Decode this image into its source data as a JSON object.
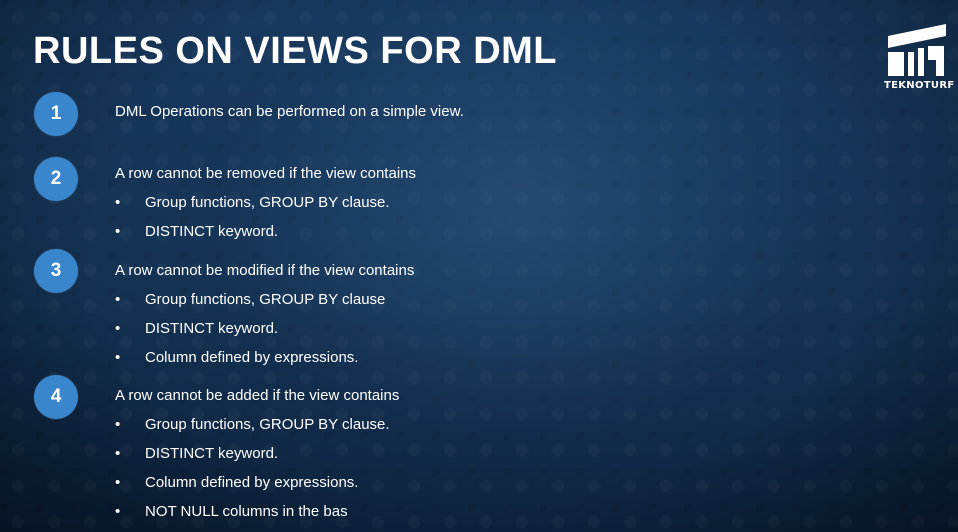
{
  "slide": {
    "title": "RULES ON VIEWS FOR DML",
    "logo": {
      "text": "TEKNOTURF",
      "icon": "teknoturf-logo-icon"
    },
    "rules": [
      {
        "number": "1",
        "heading": "DML Operations can be performed on a simple view.",
        "bullets": []
      },
      {
        "number": "2",
        "heading": "A row cannot be removed if the view contains",
        "bullets": [
          "Group functions,  GROUP BY clause.",
          "DISTINCT keyword."
        ]
      },
      {
        "number": "3",
        "heading": "A row cannot be modified if the view contains",
        "bullets": [
          "Group functions,  GROUP BY clause",
          "DISTINCT keyword.",
          "Column defined by expressions."
        ]
      },
      {
        "number": "4",
        "heading": "A row cannot be added if the view contains",
        "bullets": [
          "Group functions,  GROUP BY clause.",
          "DISTINCT keyword.",
          "Column defined by expressions.",
          "NOT NULL columns in the bas"
        ]
      }
    ],
    "bullet_glyph": "•",
    "colors": {
      "accent": "#3a86cc",
      "background": "#12304f",
      "text": "#ffffff"
    }
  }
}
